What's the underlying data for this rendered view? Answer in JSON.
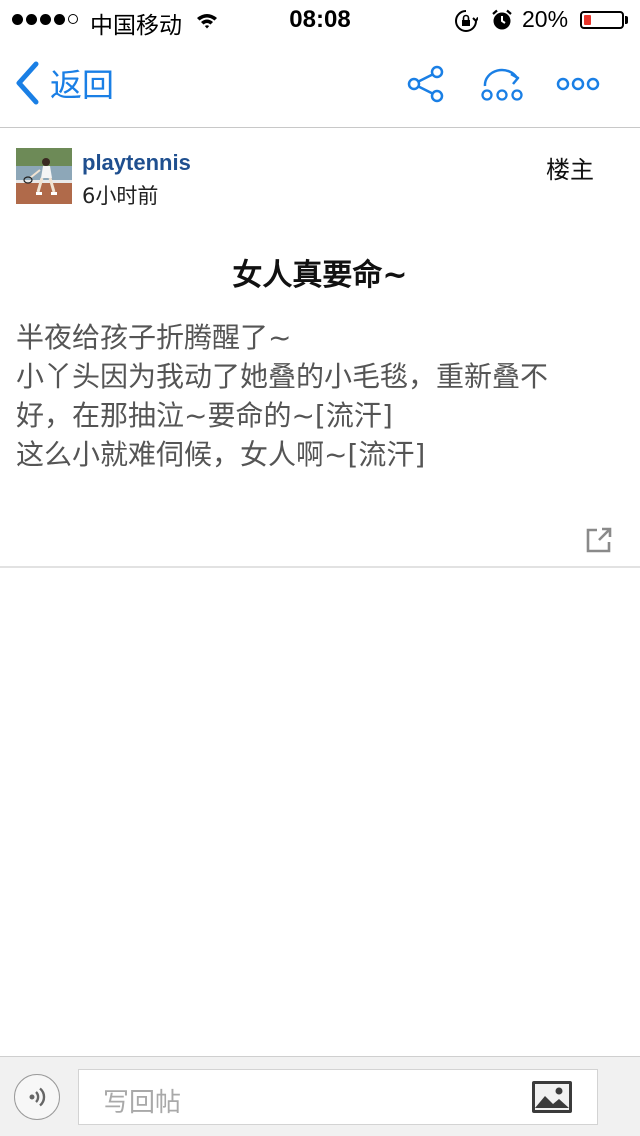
{
  "status_bar": {
    "carrier": "中国移动",
    "time": "08:08",
    "battery_percent": "20%",
    "battery_level": 0.2,
    "battery_color": "#e8352b",
    "signal_bars_filled": 4,
    "signal_bars_total": 5
  },
  "nav": {
    "back_label": "返回",
    "accent_color": "#1a7fe5",
    "icons": [
      "share-icon",
      "redirect-icon",
      "more-icon"
    ]
  },
  "post": {
    "author": "playtennis",
    "time_ago": "6小时前",
    "floor_label": "楼主",
    "title": "女人真要命~",
    "body_lines": [
      "半夜给孩子折腾醒了~",
      "小丫头因为我动了她叠的小毛毯，重新叠不",
      "好，在那抽泣~要命的~[流汗]",
      "这么小就难伺候，女人啊~[流汗]"
    ]
  },
  "reply_bar": {
    "placeholder": "写回帖"
  }
}
